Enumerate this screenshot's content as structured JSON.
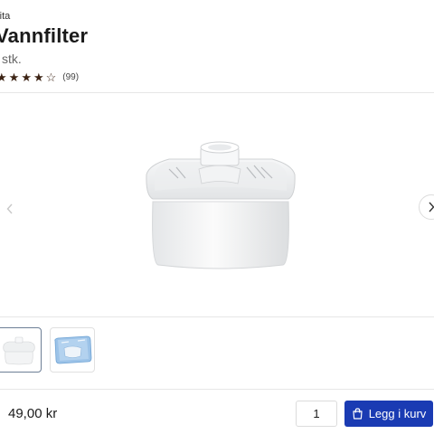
{
  "product": {
    "brand": "rita",
    "title": "Vannfilter",
    "unit": "stk.",
    "rating": {
      "value": 4,
      "max": 5,
      "count_label": "(99)"
    },
    "price": "49,00 kr"
  },
  "gallery": {
    "prev_icon": "chevron-left-icon",
    "next_icon": "chevron-right-icon",
    "active_index": 0,
    "thumbnails": [
      "filter-cartridge-thumbnail",
      "filter-package-thumbnail"
    ]
  },
  "cart": {
    "quantity": "1",
    "add_label": "Legg i kurv",
    "icon": "shopping-bag-icon",
    "accent_color": "#1a3bb3"
  },
  "colors": {
    "star": "#3d2415",
    "active_thumb_border": "#6d7f96"
  }
}
